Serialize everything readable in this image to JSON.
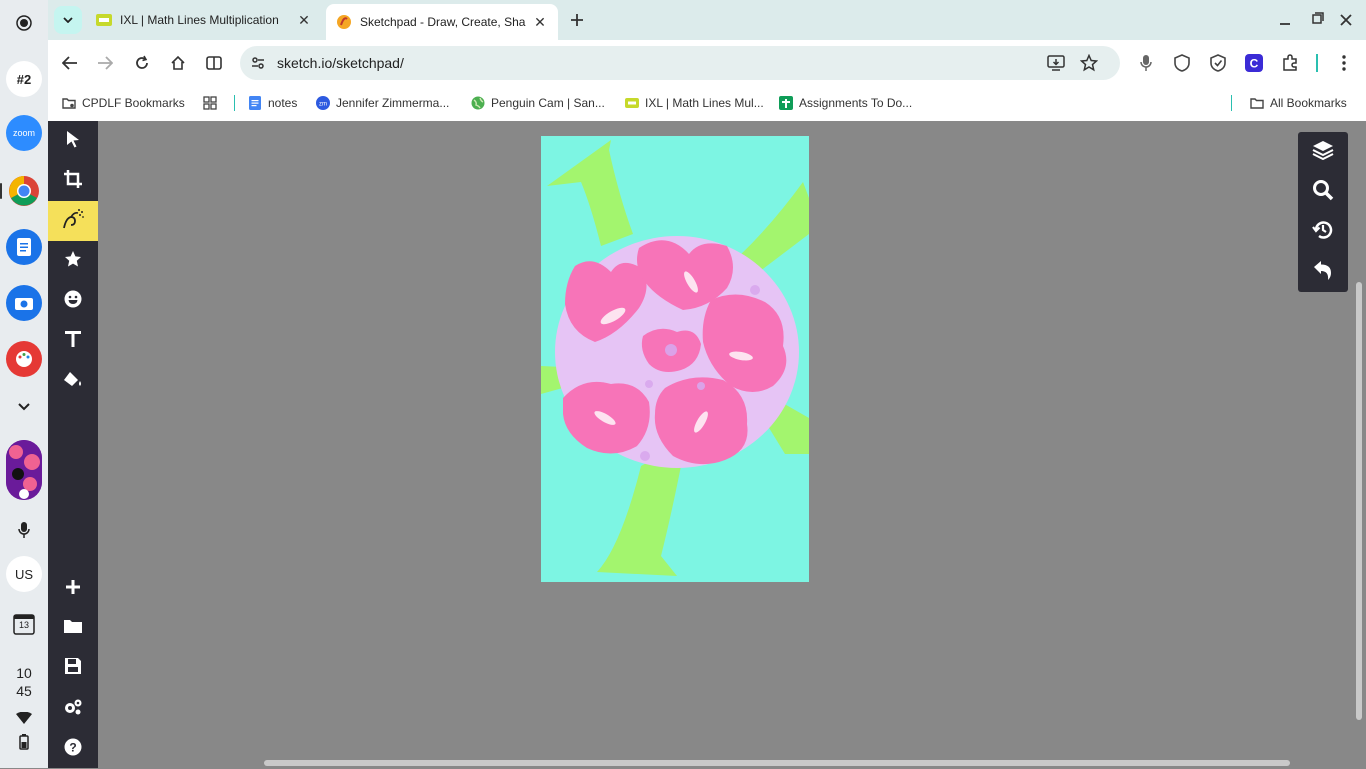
{
  "shelf": {
    "badge_label": "#2",
    "zoom_label": "zoom",
    "locale_label": "US",
    "calendar_day": "13",
    "time_hour": "10",
    "time_minute": "45"
  },
  "tabs": [
    {
      "title": "IXL | Math Lines Multiplication",
      "icon": "ixl-icon",
      "active": false
    },
    {
      "title": "Sketchpad - Draw, Create, Share",
      "icon": "sketchpad-icon",
      "active": true
    }
  ],
  "address_bar": {
    "url": "sketch.io/sketchpad/"
  },
  "bookmarks": [
    {
      "label": "CPDLF Bookmarks",
      "icon": "folder-settings-icon"
    },
    {
      "label": "notes",
      "icon": "docs-icon"
    },
    {
      "label": "Jennifer Zimmerma...",
      "icon": "zoom-icon"
    },
    {
      "label": "Penguin Cam | San...",
      "icon": "globe-icon"
    },
    {
      "label": "IXL | Math Lines Mul...",
      "icon": "ixl-icon"
    },
    {
      "label": "Assignments To Do...",
      "icon": "classroom-icon"
    }
  ],
  "all_bookmarks_label": "All Bookmarks",
  "colors": {
    "canvas_background": "#7df5e3",
    "petal_pink": "#f774b8",
    "petal_lavender": "#e6c4f5",
    "leaf_green": "#a3f56e",
    "tool_rail": "#2c2c35",
    "selected_tool": "#f5e05a",
    "workspace": "#888888"
  }
}
